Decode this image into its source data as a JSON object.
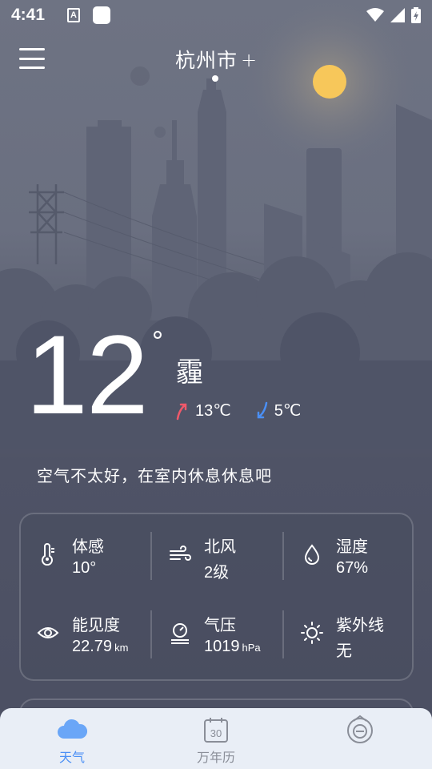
{
  "status_bar": {
    "time": "4:41",
    "notif_icon_letter": "A"
  },
  "header": {
    "city": "杭州市",
    "add_icon": "+"
  },
  "current": {
    "temperature": "12",
    "degree": "°",
    "condition": "霾",
    "high": "13℃",
    "low": "5℃",
    "advice": "空气不太好，在室内休息休息吧"
  },
  "details": [
    {
      "label": "体感",
      "value": "10°",
      "unit": "",
      "icon": "thermometer-icon"
    },
    {
      "label": "北风",
      "value": "2级",
      "unit": "",
      "icon": "wind-icon"
    },
    {
      "label": "湿度",
      "value": "67%",
      "unit": "",
      "icon": "humidity-drop-icon"
    },
    {
      "label": "能见度",
      "value": "22.79",
      "unit": "km",
      "icon": "eye-icon"
    },
    {
      "label": "气压",
      "value": "1019",
      "unit": "hPa",
      "icon": "pressure-gauge-icon"
    },
    {
      "label": "紫外线",
      "value": "无",
      "unit": "",
      "icon": "sun-uv-icon"
    }
  ],
  "nav": [
    {
      "label": "天气",
      "icon": "cloud-icon",
      "active": true
    },
    {
      "label": "万年历",
      "icon": "calendar-icon",
      "day": "30",
      "active": false
    },
    {
      "label": "",
      "icon": "fortune-icon",
      "active": false
    }
  ],
  "colors": {
    "accent_blue": "#4a8ff5",
    "high_arrow": "#f0596a",
    "low_arrow": "#4a8ff5",
    "sun": "#f7c75a",
    "nav_bg": "#e9eef6"
  }
}
